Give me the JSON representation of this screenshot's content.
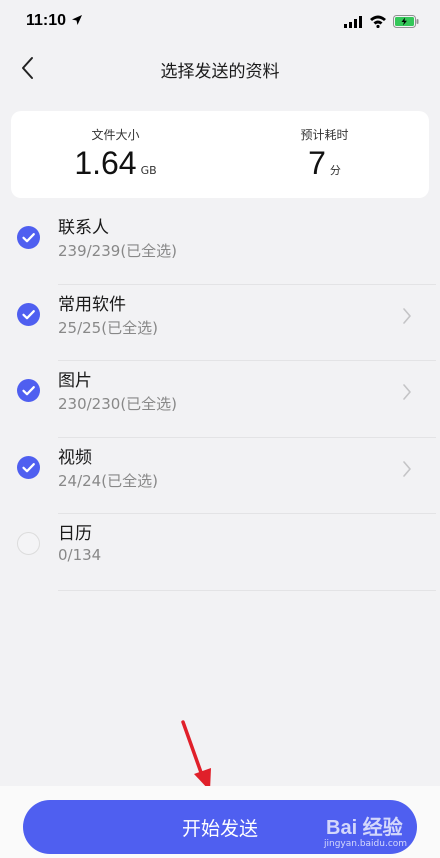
{
  "status_bar": {
    "time": "11:10"
  },
  "header": {
    "title": "选择发送的资料"
  },
  "summary": {
    "size_label": "文件大小",
    "size_value": "1.64",
    "size_unit": "GB",
    "time_label": "预计耗时",
    "time_value": "7",
    "time_unit": "分"
  },
  "items": [
    {
      "title": "联系人",
      "count": "239/239(已全选)",
      "checked": true,
      "has_chevron": false
    },
    {
      "title": "常用软件",
      "count": "25/25(已全选)",
      "checked": true,
      "has_chevron": true
    },
    {
      "title": "图片",
      "count": "230/230(已全选)",
      "checked": true,
      "has_chevron": true
    },
    {
      "title": "视频",
      "count": "24/24(已全选)",
      "checked": true,
      "has_chevron": true
    },
    {
      "title": "日历",
      "count": "0/134",
      "checked": false,
      "has_chevron": false
    }
  ],
  "footer": {
    "start_label": "开始发送"
  },
  "watermark": {
    "brand": "Bai 经验",
    "url": "jingyan.baidu.com"
  },
  "colors": {
    "accent": "#4f5ff0",
    "background": "#f2f2f4",
    "annotation": "#e0202a"
  }
}
